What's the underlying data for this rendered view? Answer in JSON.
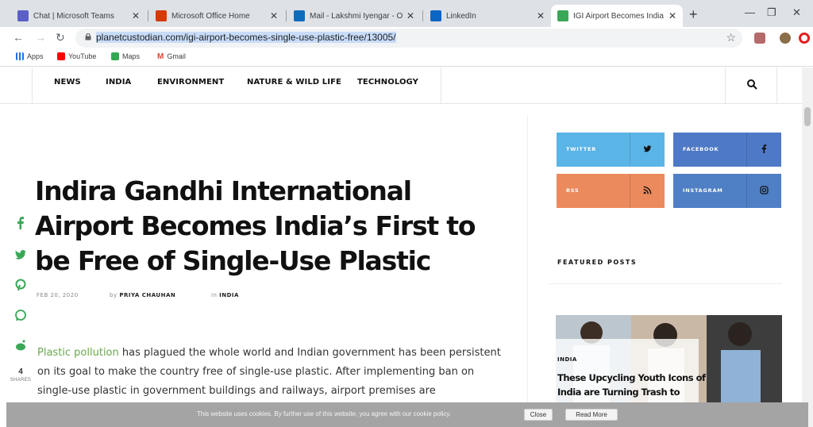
{
  "browser": {
    "tabs": [
      {
        "title": "Chat | Microsoft Teams",
        "icon": "teams-icon",
        "color": "#5b5fc7"
      },
      {
        "title": "Microsoft Office Home",
        "icon": "office-icon",
        "color": "#d83b01"
      },
      {
        "title": "Mail - Lakshmi Iyengar - O...",
        "icon": "outlook-icon",
        "color": "#0f6cbd"
      },
      {
        "title": "LinkedIn",
        "icon": "linkedin-icon",
        "color": "#0a66c2"
      },
      {
        "title": "IGI Airport Becomes India ...",
        "icon": "site-icon",
        "color": "#3aa757",
        "active": true
      }
    ],
    "url": "planetcustodian.com/igi-airport-becomes-single-use-plastic-free/13005/",
    "bookmarks": [
      {
        "label": "Apps",
        "icon": "apps-grid-icon",
        "color": "#1a73e8"
      },
      {
        "label": "YouTube",
        "icon": "youtube-icon",
        "color": "#ff0000"
      },
      {
        "label": "Maps",
        "icon": "maps-icon",
        "color": "#34a853"
      },
      {
        "label": "Gmail",
        "icon": "gmail-icon",
        "color": "#ea4335"
      }
    ]
  },
  "site": {
    "nav": [
      "NEWS",
      "INDIA",
      "ENVIRONMENT",
      "NATURE & WILD LIFE",
      "TECHNOLOGY"
    ],
    "social": [
      {
        "label": "TWITTER",
        "icon": "twitter-icon",
        "color": "#5ab4e6"
      },
      {
        "label": "FACEBOOK",
        "icon": "facebook-icon",
        "color": "#4e79c6"
      },
      {
        "label": "RSS",
        "icon": "rss-icon",
        "color": "#eb8a5c"
      },
      {
        "label": "INSTAGRAM",
        "icon": "instagram-icon",
        "color": "#4f7fc4"
      }
    ]
  },
  "article": {
    "headline": "Indira Gandhi International Airport Becomes India’s First to be Free of Single-Use Plastic",
    "date": "FEB 20, 2020",
    "author_prefix": "by",
    "author": "PRIYA CHAUHAN",
    "category_prefix": "in",
    "category": "INDIA",
    "share_count": "4",
    "share_label": "SHARES",
    "body_link": "Plastic pollution",
    "body_rest": " has plagued the whole world and Indian government has been persistent on its goal to make the country free of single-use plastic. After implementing ban on single-use plastic in government buildings and railways, airport premises are"
  },
  "sidebar": {
    "featured_title": "FEATURED POSTS",
    "featured_category": "INDIA",
    "featured_headline": "These Upcycling Youth Icons of India are Turning Trash to"
  },
  "cookie": {
    "text": "This website uses cookies. By further use of this website, you agree with our cookie policy.",
    "close": "Close",
    "read_more": "Read More"
  }
}
